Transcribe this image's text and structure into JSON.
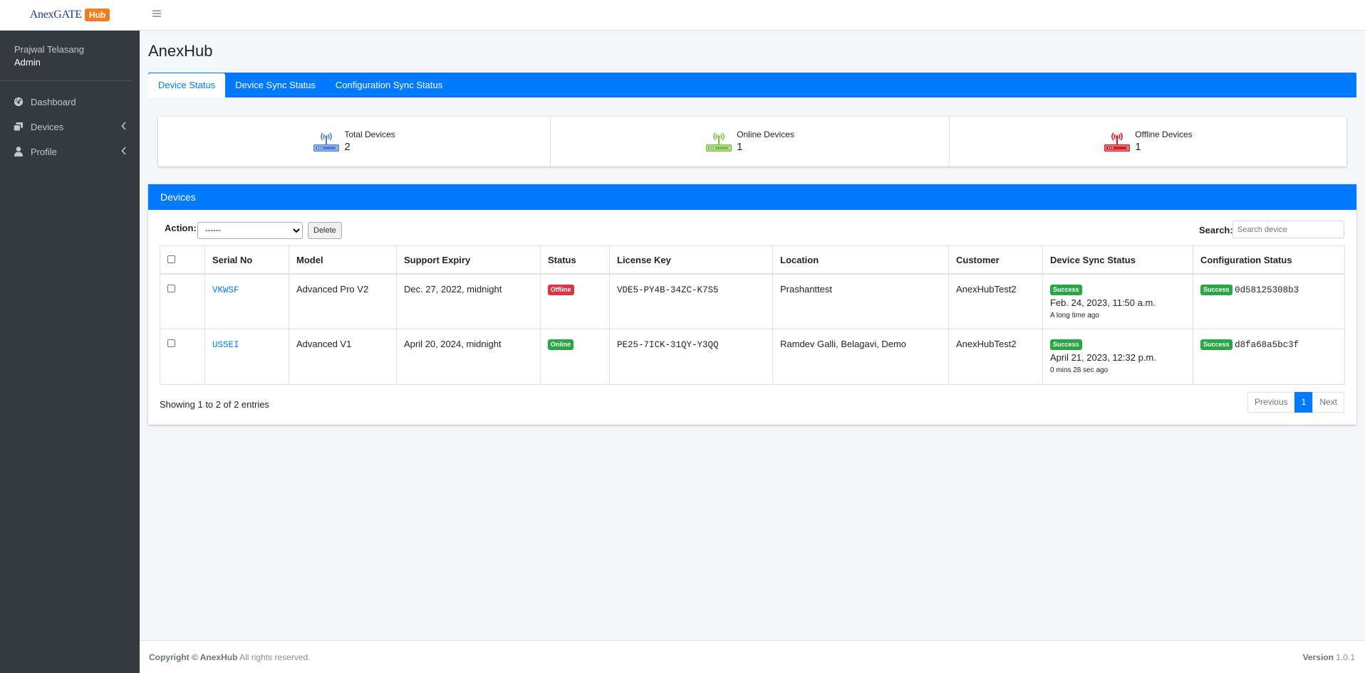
{
  "brand": {
    "name": "AnexGATE",
    "badge": "Hub"
  },
  "user": {
    "name": "Prajwal Telasang",
    "role": "Admin"
  },
  "nav": [
    {
      "label": "Dashboard",
      "icon": "dashboard-icon"
    },
    {
      "label": "Devices",
      "icon": "devices-icon"
    },
    {
      "label": "Profile",
      "icon": "user-icon"
    }
  ],
  "page": {
    "title": "AnexHub"
  },
  "tabs": [
    {
      "label": "Device Status",
      "active": true
    },
    {
      "label": "Device Sync Status",
      "active": false
    },
    {
      "label": "Configuration Sync Status",
      "active": false
    }
  ],
  "stats": [
    {
      "label": "Total Devices",
      "value": "2",
      "color": "#4a7fe0"
    },
    {
      "label": "Online Devices",
      "value": "1",
      "color": "#7ac142"
    },
    {
      "label": "Offline Devices",
      "value": "1",
      "color": "#d6181f"
    }
  ],
  "devices_card": {
    "title": "Devices",
    "action_label": "Action:",
    "action_selected": "------",
    "delete_label": "Delete",
    "search_label": "Search:",
    "search_placeholder": "Search device",
    "columns": [
      "Serial No",
      "Model",
      "Support Expiry",
      "Status",
      "License Key",
      "Location",
      "Customer",
      "Device Sync Status",
      "Configuration Status"
    ],
    "rows": [
      {
        "serial": "VKWSF",
        "model": "Advanced Pro V2",
        "expiry": "Dec. 27, 2022, midnight",
        "status": "Offline",
        "license": "VDE5-PY4B-34ZC-K7S5",
        "location": "Prashanttest",
        "customer": "AnexHubTest2",
        "sync_badge": "Success",
        "sync_date": "Feb. 24, 2023, 11:50 a.m.",
        "sync_ago": "A long time ago",
        "config_badge": "Success",
        "config_hash": "0d58125308b3"
      },
      {
        "serial": "USSEI",
        "model": "Advanced V1",
        "expiry": "April 20, 2024, midnight",
        "status": "Online",
        "license": "PE25-7ICK-31QY-Y3QQ",
        "location": "Ramdev Galli, Belagavi, Demo",
        "customer": "AnexHubTest2",
        "sync_badge": "Success",
        "sync_date": "April 21, 2023, 12:32 p.m.",
        "sync_ago": "0 mins 28 sec ago",
        "config_badge": "Success",
        "config_hash": "d8fa68a5bc3f"
      }
    ],
    "showing": "Showing 1 to 2 of 2 entries",
    "pagination": {
      "previous": "Previous",
      "current": "1",
      "next": "Next"
    }
  },
  "footer": {
    "copyright_prefix": "Copyright © AnexHub",
    "copyright_suffix": "All rights reserved.",
    "version_label": "Version",
    "version": "1.0.1"
  }
}
